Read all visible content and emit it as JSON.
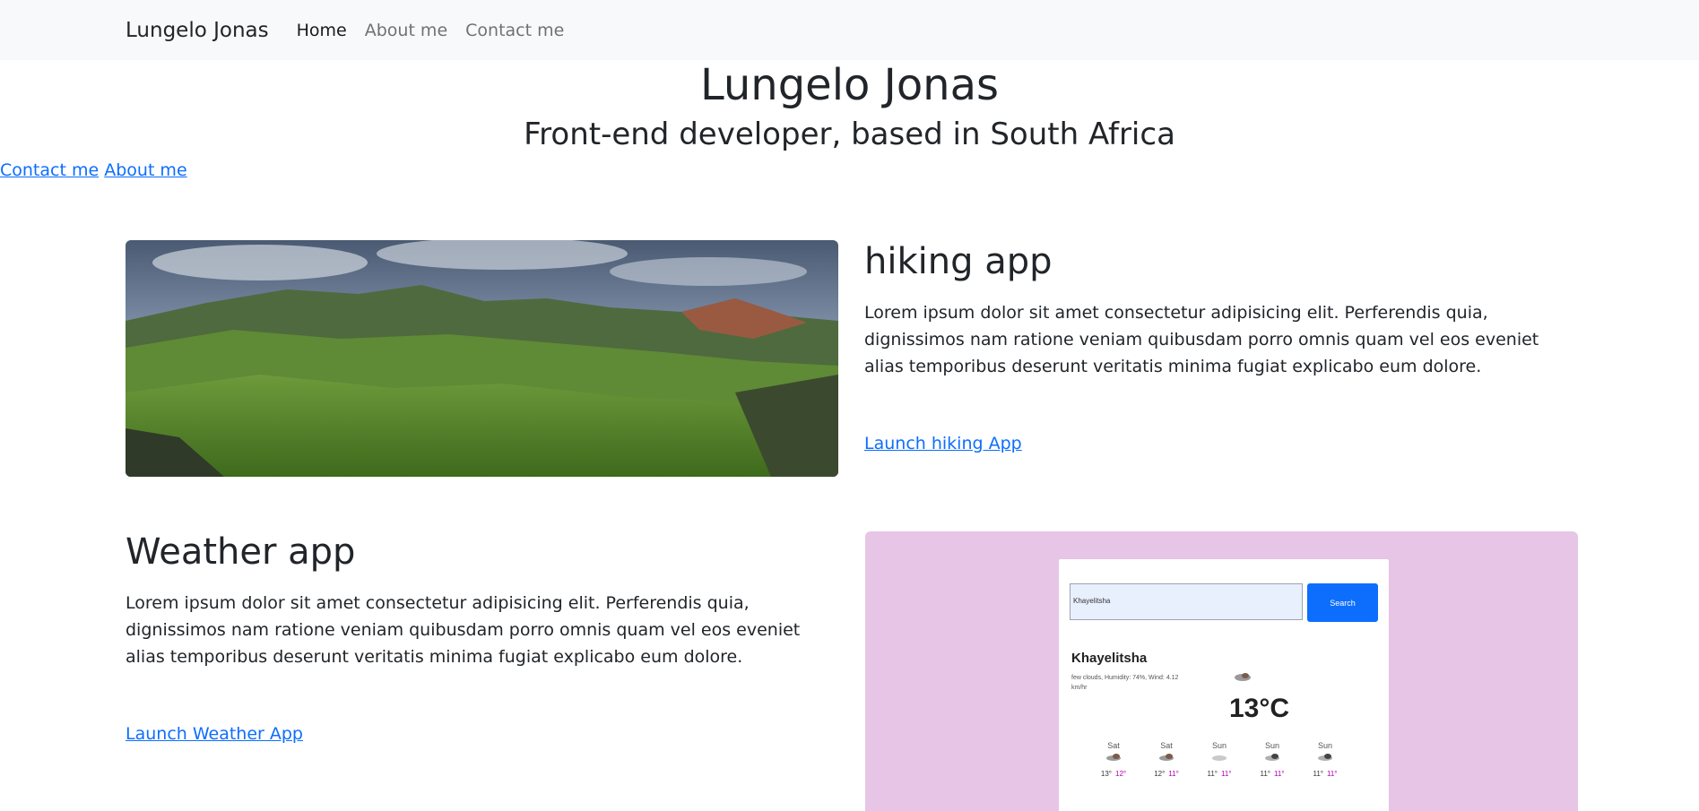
{
  "nav": {
    "brand": "Lungelo Jonas",
    "links": [
      "Home",
      "About me",
      "Contact me"
    ]
  },
  "hero": {
    "title": "Lungelo Jonas",
    "subtitle": "Front-end developer, based in South Africa",
    "contact_link": "Contact me",
    "about_link": "About me"
  },
  "projects": {
    "hiking": {
      "title": "hiking app",
      "description": "Lorem ipsum dolor sit amet consectetur adipisicing elit. Perferendis quia, dignissimos nam ratione veniam quibusdam porro omnis quam vel eos eveniet alias temporibus deserunt veritatis minima fugiat explicabo eum dolore.",
      "link": "Launch hiking App"
    },
    "weather": {
      "title": "Weather app",
      "description": "Lorem ipsum dolor sit amet consectetur adipisicing elit. Perferendis quia, dignissimos nam ratione veniam quibusdam porro omnis quam vel eos eveniet alias temporibus deserunt veritatis minima fugiat explicabo eum dolore.",
      "link": "Launch Weather App"
    }
  },
  "weather_preview": {
    "search_value": "Khayelitsha",
    "search_button": "Search",
    "city": "Khayelitsha",
    "details": "few clouds, Humidity: 74%, Wind: 4.12 km/hr",
    "temperature": "13°C",
    "forecast": [
      {
        "day": "Sat",
        "max": "13°",
        "min": "12°"
      },
      {
        "day": "Sat",
        "max": "12°",
        "min": "11°"
      },
      {
        "day": "Sun",
        "max": "11°",
        "min": "11°"
      },
      {
        "day": "Sun",
        "max": "11°",
        "min": "11°"
      },
      {
        "day": "Sun",
        "max": "11°",
        "min": "11°"
      }
    ]
  },
  "colors": {
    "link": "#0d6efd",
    "navbar_bg": "#f8f9fa",
    "weather_bg": "#e6c5e6"
  }
}
